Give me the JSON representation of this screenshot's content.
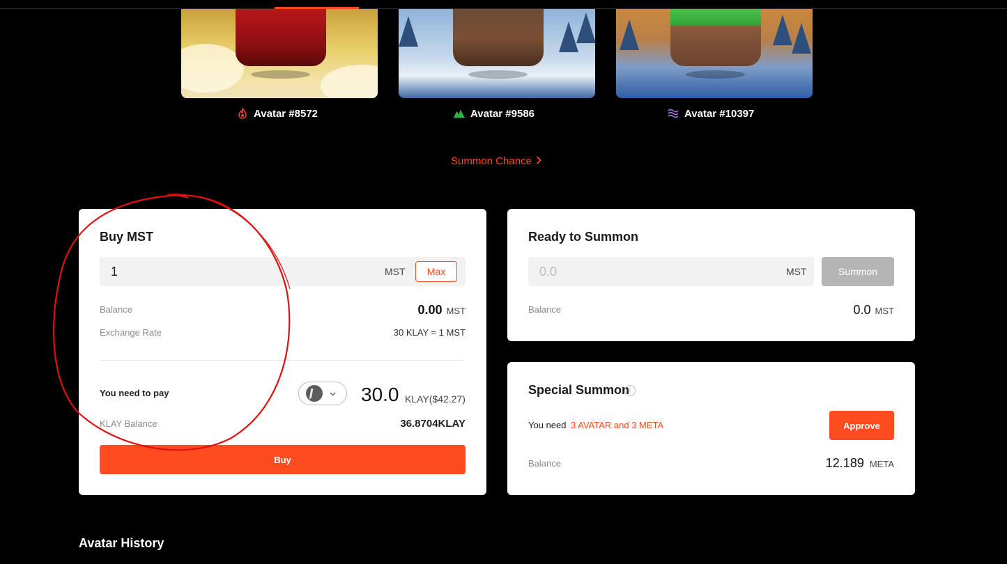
{
  "avatars": [
    {
      "label": "Avatar #8572",
      "element": "fire",
      "icon": "fire-icon",
      "color": "#e8412f"
    },
    {
      "label": "Avatar #9586",
      "element": "earth",
      "icon": "mountain-icon",
      "color": "#2fb44a"
    },
    {
      "label": "Avatar #10397",
      "element": "water",
      "icon": "wave-icon",
      "color": "#a36bd8"
    }
  ],
  "summon_chance": {
    "label": "Summon Chance",
    "icon": "chevron-right-icon"
  },
  "buy_panel": {
    "title": "Buy MST",
    "input_value": "1",
    "input_unit": "MST",
    "max_label": "Max",
    "balance_label": "Balance",
    "balance_value": "0.00",
    "balance_unit": "MST",
    "rate_label": "Exchange Rate",
    "rate_value": "30 KLAY = 1 MST",
    "pay_label": "You need to pay",
    "token_icon": "klay-icon",
    "pay_amount": "30.0",
    "pay_unit": "KLAY($42.27)",
    "klay_balance_label": "KLAY Balance",
    "klay_balance_value": "36.8704KLAY",
    "buy_label": "Buy"
  },
  "ready_panel": {
    "title": "Ready to Summon",
    "input_placeholder": "0.0",
    "input_unit": "MST",
    "summon_label": "Summon",
    "balance_label": "Balance",
    "balance_value": "0.0",
    "balance_unit": "MST"
  },
  "special_panel": {
    "title": "Special Summon",
    "need_text": "You need",
    "need_accent": "3 AVATAR and 3 META",
    "approve_label": "Approve",
    "balance_label": "Balance",
    "balance_value": "12.189",
    "balance_unit": "META"
  },
  "history_title": "Avatar History",
  "colors": {
    "accent": "#ff4b1f",
    "disabled": "#b5b5b5",
    "annotation": "#e01010"
  }
}
